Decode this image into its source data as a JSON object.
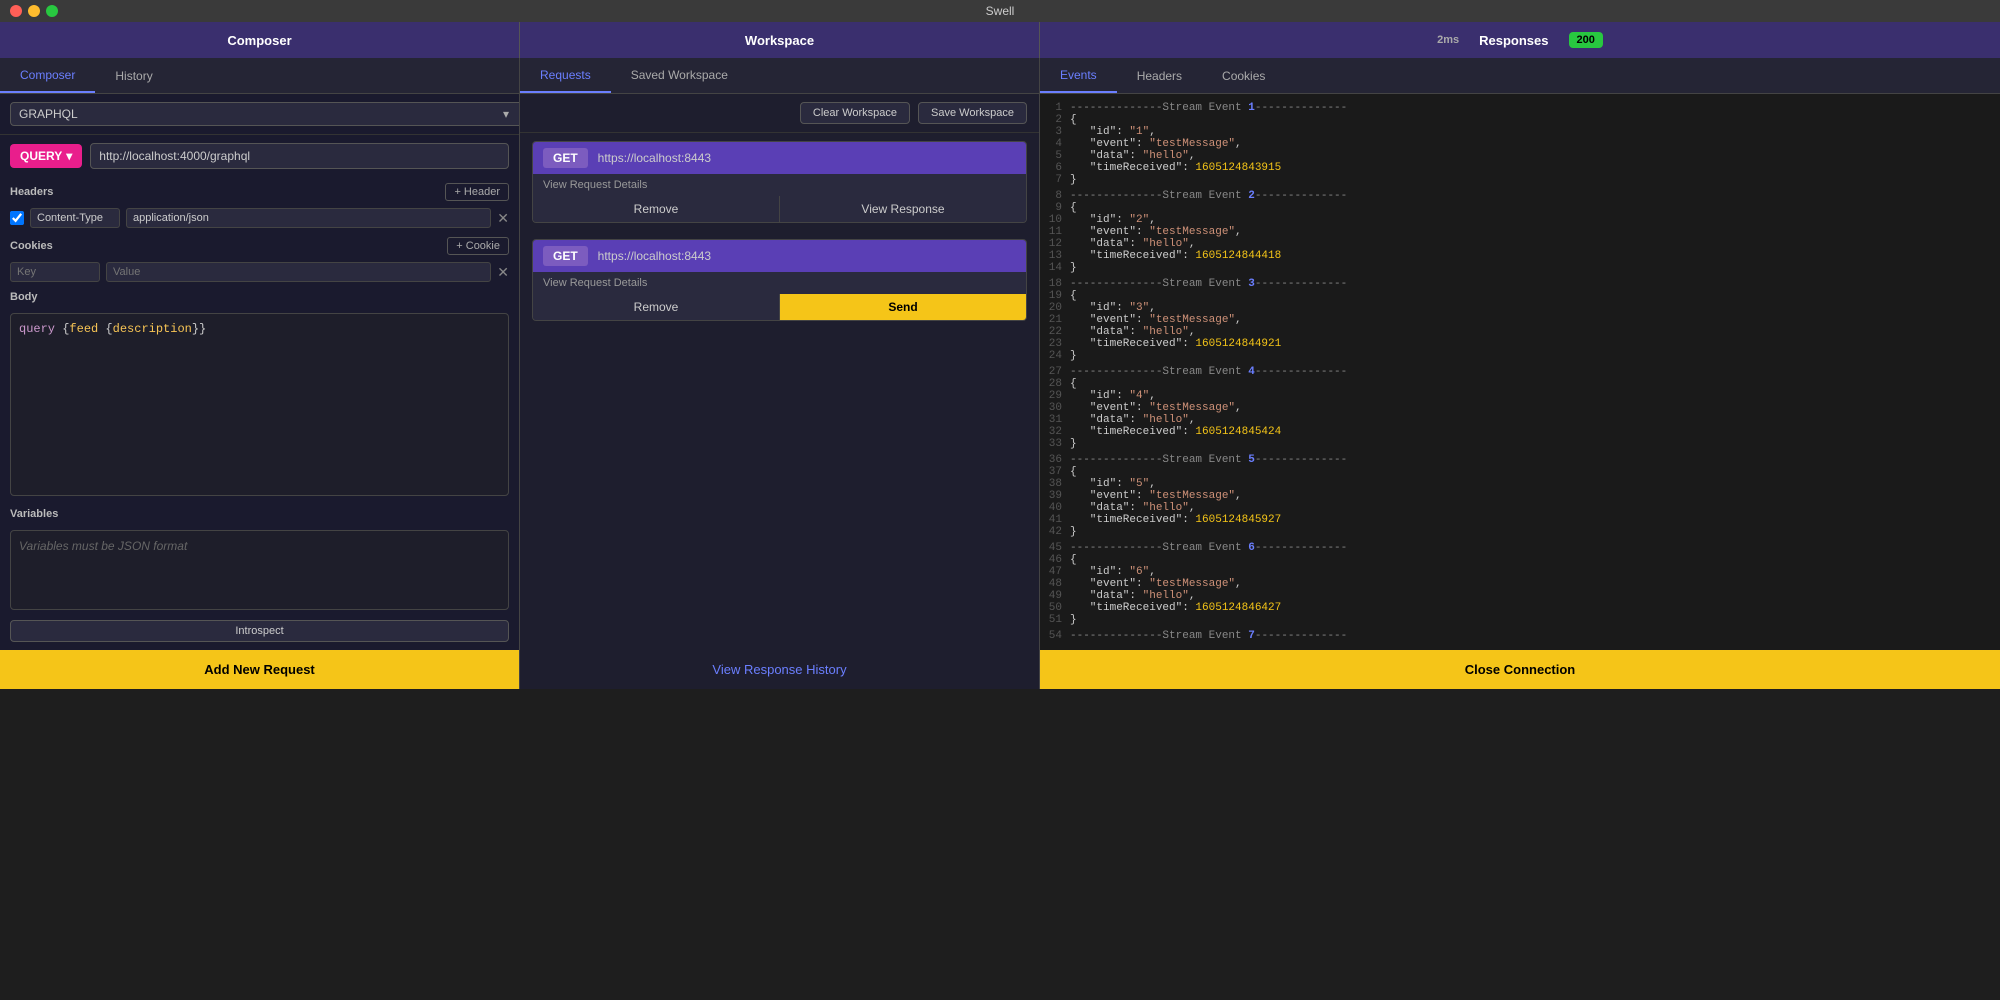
{
  "app": {
    "title": "Swell"
  },
  "titlebar": {
    "title": "Swell"
  },
  "composer": {
    "header": "Composer",
    "tabs": [
      {
        "label": "Composer",
        "active": true
      },
      {
        "label": "History",
        "active": false
      }
    ],
    "graphql_value": "GRAPHQL",
    "method_label": "QUERY",
    "url_value": "http://localhost:4000/graphql",
    "headers_label": "Headers",
    "add_header_label": "+ Header",
    "header_rows": [
      {
        "checked": true,
        "key": "Content-Type",
        "value": "application/json"
      }
    ],
    "cookies_label": "Cookies",
    "add_cookie_label": "+ Cookie",
    "cookie_placeholder_key": "Key",
    "cookie_placeholder_value": "Value",
    "body_label": "Body",
    "body_code": "query {feed {description}}",
    "variables_label": "Variables",
    "variables_placeholder": "Variables must be JSON format",
    "introspect_label": "Introspect",
    "add_request_label": "Add New Request"
  },
  "workspace": {
    "header": "Workspace",
    "tabs": [
      {
        "label": "Requests",
        "active": true
      },
      {
        "label": "Saved Workspace",
        "active": false
      }
    ],
    "clear_label": "Clear Workspace",
    "save_label": "Save Workspace",
    "requests": [
      {
        "method": "GET",
        "url": "https://localhost:8443",
        "details_label": "View Request Details",
        "remove_label": "Remove",
        "view_label": "View Response",
        "has_send": false
      },
      {
        "method": "GET",
        "url": "https://localhost:8443",
        "details_label": "View Request Details",
        "remove_label": "Remove",
        "send_label": "Send",
        "has_send": true
      }
    ],
    "view_history_label": "View Response History"
  },
  "responses": {
    "header": "Responses",
    "ms": "2ms",
    "badge": "200",
    "tabs": [
      {
        "label": "Events",
        "active": true
      },
      {
        "label": "Headers",
        "active": false
      },
      {
        "label": "Cookies",
        "active": false
      }
    ],
    "events": [
      {
        "event_num": "1",
        "header_prefix": "--------------Stream Event ",
        "header_suffix": "--------------",
        "lines": [
          {
            "num": "",
            "text": "",
            "type": "open_brace"
          },
          {
            "num": "2",
            "key": "id",
            "value": "\"1\"",
            "type": "kv_str"
          },
          {
            "num": "3",
            "key": "event",
            "value": "\"testMessage\"",
            "type": "kv_str"
          },
          {
            "num": "4",
            "key": "data",
            "value": "\"hello\"",
            "type": "kv_str"
          },
          {
            "num": "5",
            "key": "timeReceived",
            "value": "1605124843915",
            "type": "kv_ts"
          },
          {
            "num": "6",
            "text": "}",
            "type": "close_brace"
          }
        ]
      },
      {
        "event_num": "2",
        "lines": [
          {
            "num": "8",
            "text": "{",
            "type": "open_brace"
          },
          {
            "num": "9",
            "key": "id",
            "value": "\"2\"",
            "type": "kv_str"
          },
          {
            "num": "10",
            "key": "event",
            "value": "\"testMessage\"",
            "type": "kv_str"
          },
          {
            "num": "11",
            "key": "data",
            "value": "\"hello\"",
            "type": "kv_str"
          },
          {
            "num": "12",
            "key": "timeReceived",
            "value": "1605124844418",
            "type": "kv_ts"
          },
          {
            "num": "13",
            "text": "}",
            "type": "close_brace"
          }
        ]
      },
      {
        "event_num": "3",
        "lines": [
          {
            "num": "18",
            "text": "{",
            "type": "open_brace"
          },
          {
            "num": "19",
            "key": "id",
            "value": "\"3\"",
            "type": "kv_str"
          },
          {
            "num": "20",
            "key": "event",
            "value": "\"testMessage\"",
            "type": "kv_str"
          },
          {
            "num": "21",
            "key": "data",
            "value": "\"hello\"",
            "type": "kv_str"
          },
          {
            "num": "22",
            "key": "timeReceived",
            "value": "1605124844921",
            "type": "kv_ts"
          },
          {
            "num": "23",
            "text": "}",
            "type": "close_brace"
          }
        ]
      },
      {
        "event_num": "4",
        "lines": [
          {
            "num": "27",
            "text": "{",
            "type": "open_brace"
          },
          {
            "num": "28",
            "key": "id",
            "value": "\"4\"",
            "type": "kv_str"
          },
          {
            "num": "29",
            "key": "event",
            "value": "\"testMessage\"",
            "type": "kv_str"
          },
          {
            "num": "30",
            "key": "data",
            "value": "\"hello\"",
            "type": "kv_str"
          },
          {
            "num": "31",
            "key": "timeReceived",
            "value": "1605124845424",
            "type": "kv_ts"
          },
          {
            "num": "32",
            "text": "}",
            "type": "close_brace"
          }
        ]
      },
      {
        "event_num": "5",
        "lines": [
          {
            "num": "36",
            "text": "{",
            "type": "open_brace"
          },
          {
            "num": "37",
            "key": "id",
            "value": "\"5\"",
            "type": "kv_str"
          },
          {
            "num": "38",
            "key": "event",
            "value": "\"testMessage\"",
            "type": "kv_str"
          },
          {
            "num": "39",
            "key": "data",
            "value": "\"hello\"",
            "type": "kv_str"
          },
          {
            "num": "40",
            "key": "timeReceived",
            "value": "1605124845927",
            "type": "kv_ts"
          },
          {
            "num": "41",
            "text": "}",
            "type": "close_brace"
          }
        ]
      },
      {
        "event_num": "6",
        "lines": [
          {
            "num": "45",
            "text": "{",
            "type": "open_brace"
          },
          {
            "num": "46",
            "key": "id",
            "value": "\"6\"",
            "type": "kv_str"
          },
          {
            "num": "47",
            "key": "event",
            "value": "\"testMessage\"",
            "type": "kv_str"
          },
          {
            "num": "48",
            "key": "data",
            "value": "\"hello\"",
            "type": "kv_str"
          },
          {
            "num": "49",
            "key": "timeReceived",
            "value": "1605124846427",
            "type": "kv_ts"
          },
          {
            "num": "50",
            "text": "}",
            "type": "close_brace"
          }
        ]
      },
      {
        "event_num": "7",
        "lines": []
      }
    ],
    "close_label": "Close Connection"
  }
}
